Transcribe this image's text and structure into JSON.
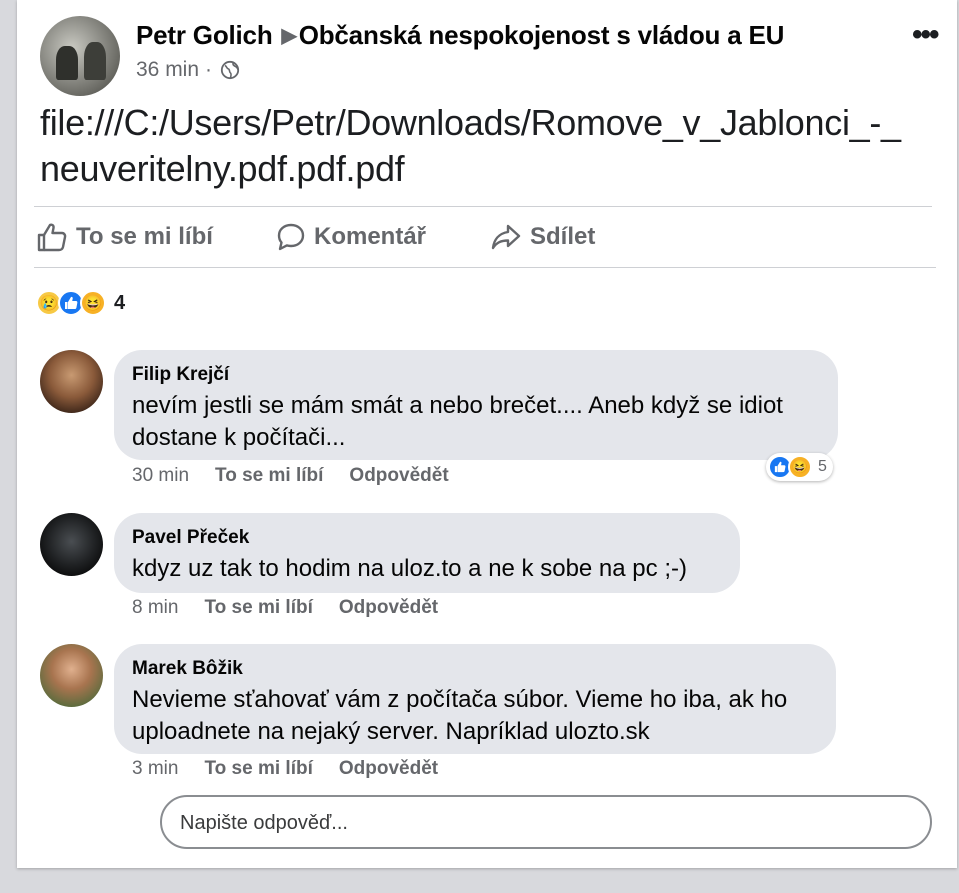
{
  "post": {
    "author": "Petr Golich",
    "group": "Občanská nespokojenost s vládou a EU",
    "time": "36 min",
    "separator": "·",
    "text": "file:///C:/Users/Petr/Downloads/Romove_v_Jablonci_-_neuveritelny.pdf.pdf.pdf",
    "more_icon": "more-horizontal-icon"
  },
  "actions": {
    "like": "To se mi líbí",
    "comment": "Komentář",
    "share": "Sdílet"
  },
  "reactions": {
    "icons": [
      "sad-reaction-icon",
      "like-reaction-icon",
      "haha-reaction-icon"
    ],
    "count": "4"
  },
  "comments": [
    {
      "name": "Filip Krejčí",
      "text": "nevím jestli se mám smát a nebo brečet.... Aneb když se idiot dostane k počítači...",
      "time": "30 min",
      "like": "To se mi líbí",
      "reply": "Odpovědět",
      "reaction_count": "5"
    },
    {
      "name": "Pavel Přeček",
      "text": "kdyz uz tak to hodim na uloz.to a ne k sobe na pc ;-)",
      "time": "8 min",
      "like": "To se mi líbí",
      "reply": "Odpovědět"
    },
    {
      "name": "Marek Bôžik",
      "text": "Nevieme sťahovať vám z počítača súbor. Vieme ho iba, ak ho uploadnete na nejaký server. Napríklad ulozto.sk",
      "time": "3 min",
      "like": "To se mi líbí",
      "reply": "Odpovědět"
    }
  ],
  "reply_box": {
    "placeholder": "Napište odpověď..."
  },
  "colors": {
    "like_blue": "#1877f2",
    "bubble": "#e4e6eb",
    "secondary_text": "#65676b"
  }
}
